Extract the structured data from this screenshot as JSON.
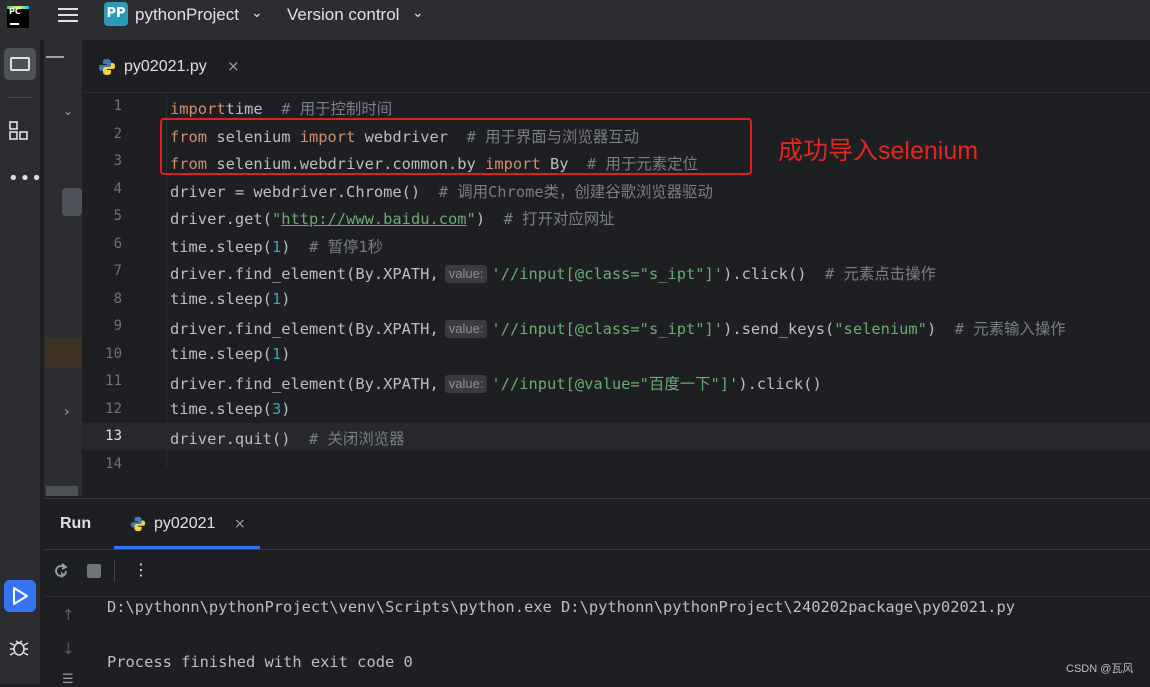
{
  "app": {
    "logo_text": "PC",
    "project_badge": "PP",
    "project_name": "pythonProject",
    "version_control_label": "Version control"
  },
  "editor_tab": {
    "file_name": "py02021.py",
    "close_glyph": "×"
  },
  "editor": {
    "current_line": 13,
    "line_numbers": [
      "1",
      "2",
      "3",
      "4",
      "5",
      "6",
      "7",
      "8",
      "9",
      "10",
      "11",
      "12",
      "13",
      "14"
    ],
    "lines": [
      [
        [
          "kw",
          "import"
        ],
        [
          "",
          "time  "
        ],
        [
          "cm",
          "# 用于控制时间"
        ]
      ],
      [
        [
          "kw",
          "from"
        ],
        [
          "",
          " selenium "
        ],
        [
          "kw",
          "import"
        ],
        [
          "",
          " webdriver  "
        ],
        [
          "cm",
          "# 用于界面与浏览器互动"
        ]
      ],
      [
        [
          "kw",
          "from"
        ],
        [
          "",
          " selenium.webdriver.common.by "
        ],
        [
          "kw",
          "import"
        ],
        [
          "",
          " By  "
        ],
        [
          "cm",
          "# 用于元素定位"
        ]
      ],
      [
        [
          "",
          "driver = webdriver.Chrome()  "
        ],
        [
          "cm",
          "# 调用Chrome类，创建谷歌浏览器驱动"
        ]
      ],
      [
        [
          "",
          "driver.get("
        ],
        [
          "str",
          "\""
        ],
        [
          "link",
          "http://www.baidu.com"
        ],
        [
          "str",
          "\""
        ],
        [
          "",
          ")  "
        ],
        [
          "cm",
          "# 打开对应网址"
        ]
      ],
      [
        [
          "",
          "time.sleep("
        ],
        [
          "num",
          "1"
        ],
        [
          "",
          ")  "
        ],
        [
          "cm",
          "# 暂停1秒"
        ]
      ],
      [
        [
          "",
          "driver.find_element(By.XPATH,"
        ],
        [
          "hint",
          "value:"
        ],
        [
          "str",
          "'//input[@class=\"s_ipt\"]'"
        ],
        [
          "",
          ").click()  "
        ],
        [
          "cm",
          "# 元素点击操作"
        ]
      ],
      [
        [
          "",
          "time.sleep("
        ],
        [
          "num",
          "1"
        ],
        [
          "",
          ")"
        ]
      ],
      [
        [
          "",
          "driver.find_element(By.XPATH,"
        ],
        [
          "hint",
          "value:"
        ],
        [
          "str",
          "'//input[@class=\"s_ipt\"]'"
        ],
        [
          "",
          ").send_keys("
        ],
        [
          "str",
          "\"selenium\""
        ],
        [
          "",
          ")  "
        ],
        [
          "cm",
          "# 元素输入操作"
        ]
      ],
      [
        [
          "",
          "time.sleep("
        ],
        [
          "num",
          "1"
        ],
        [
          "",
          ")"
        ]
      ],
      [
        [
          "",
          "driver.find_element(By.XPATH,"
        ],
        [
          "hint",
          "value:"
        ],
        [
          "str",
          "'//input[@value=\"百度一下\"]'"
        ],
        [
          "",
          ").click()"
        ]
      ],
      [
        [
          "",
          "time.sleep("
        ],
        [
          "num",
          "3"
        ],
        [
          "",
          ")"
        ]
      ],
      [
        [
          "",
          "driver.quit()  "
        ],
        [
          "cm",
          "# 关闭浏览器"
        ]
      ],
      []
    ]
  },
  "annotation": {
    "text": "成功导入selenium",
    "color": "#e4261f"
  },
  "run_panel": {
    "title": "Run",
    "tab_label": "py02021",
    "close_glyph": "×",
    "more_glyph": "⋮",
    "console_lines": [
      "D:\\pythonn\\pythonProject\\venv\\Scripts\\python.exe D:\\pythonn\\pythonProject\\240202package\\py02021.py",
      "",
      "Process finished with exit code 0"
    ]
  },
  "watermark": "CSDN @瓦风",
  "colors": {
    "keyword": "#cf8e6d",
    "comment": "#7a7e85",
    "number": "#2aacb8",
    "string": "#6aab73",
    "accent": "#3574f0",
    "highlight_box": "#e0201c"
  },
  "icons": {
    "project_tool": "folder-icon",
    "structure_tool": "structure-icon",
    "more_tools": "more-icon",
    "run_tool": "run-icon",
    "debug_tool": "bug-icon",
    "rerun": "rerun-icon",
    "stop": "stop-icon",
    "python_file": "python-icon"
  }
}
